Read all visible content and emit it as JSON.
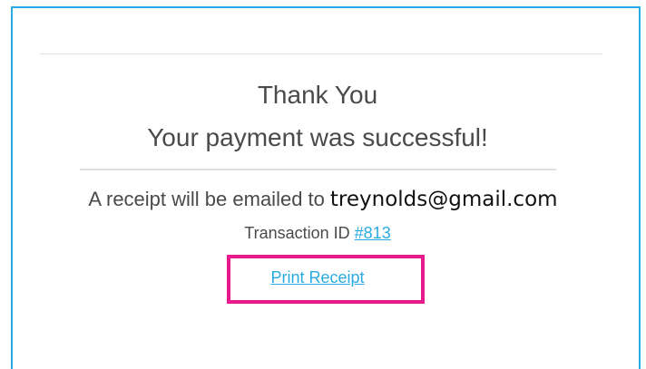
{
  "confirmation": {
    "title": "Thank You",
    "message": "Your payment was successful!",
    "receipt_prefix": "A receipt will be emailed to",
    "email": "treynolds@gmail.com",
    "transaction_label": "Transaction ID",
    "transaction_id": "#813",
    "print_receipt_label": "Print Receipt"
  },
  "colors": {
    "border": "#29abe2",
    "link": "#29abe2",
    "highlight": "#e8198b",
    "text": "#4a4a4a"
  }
}
